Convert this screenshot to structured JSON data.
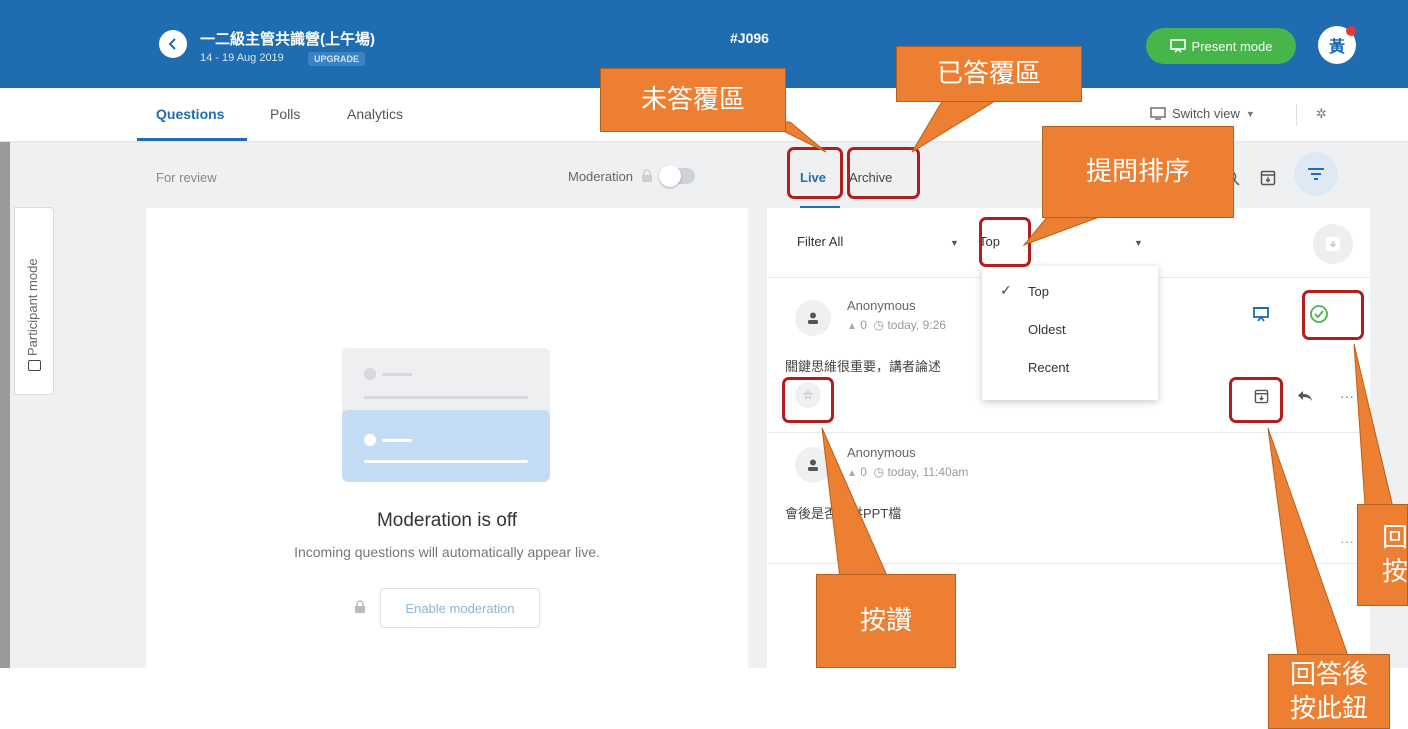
{
  "header": {
    "event_title": "一二級主管共識營(上午場)",
    "event_dates": "14 - 19 Aug 2019",
    "upgrade_badge": "UPGRADE",
    "event_code": "#J096",
    "present_mode_label": "Present mode",
    "avatar_initial": "黃"
  },
  "tabs": {
    "questions": "Questions",
    "polls": "Polls",
    "analytics": "Analytics",
    "switch_view": "Switch view"
  },
  "left_panel": {
    "for_review": "For review",
    "moderation_label": "Moderation",
    "moderation_enabled": false,
    "empty_title": "Moderation is off",
    "empty_desc": "Incoming questions will automatically appear live.",
    "enable_button": "Enable moderation"
  },
  "right_panel": {
    "tab_live": "Live",
    "tab_archive": "Archive",
    "filter_label": "Filter All",
    "sort_label": "Top",
    "sort_options": [
      "Top",
      "Oldest",
      "Recent"
    ],
    "selected_sort": "Top",
    "questions": [
      {
        "author": "Anonymous",
        "likes": "0",
        "time": "today, 9:26",
        "text": "關鍵思維很重要，講者論述"
      },
      {
        "author": "Anonymous",
        "likes": "0",
        "time": "today, 11:40am",
        "text": "會後是否提供PPT檔"
      }
    ]
  },
  "sidebar": {
    "participant_mode": "Participant mode"
  },
  "annotations": {
    "unanswered": "未答覆區",
    "answered": "已答覆區",
    "sort_order": "提問排序",
    "like": "按讚",
    "archive_after_answer": [
      "回答後",
      "按此鈕"
    ],
    "mark_answered_clip": [
      "回",
      "按"
    ]
  },
  "colors": {
    "brand_blue": "#1f6db0",
    "present_green": "#46b54a",
    "callout_orange": "#ec7f31",
    "highlight_red": "#b01e1e"
  }
}
